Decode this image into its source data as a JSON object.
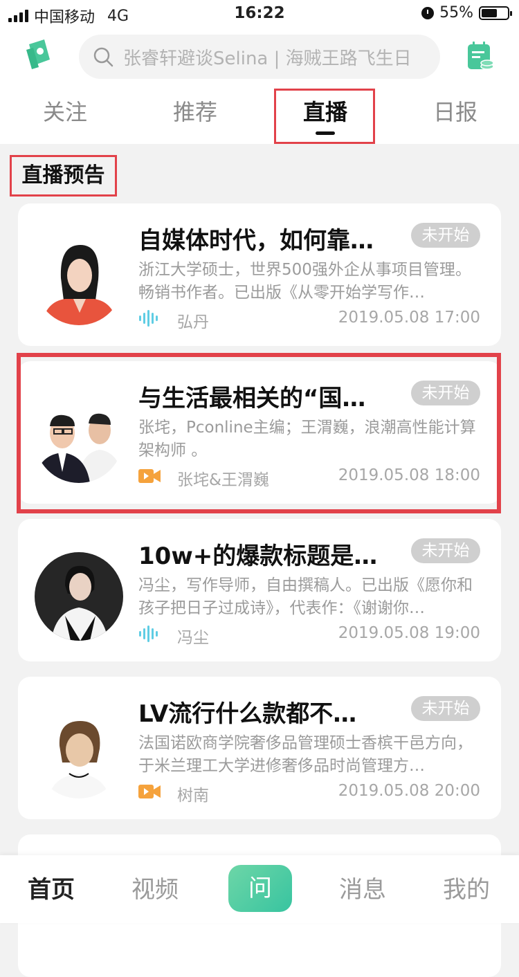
{
  "status_bar": {
    "carrier": "中国移动",
    "network": "4G",
    "time": "16:22",
    "battery": "55%",
    "battery_level": 0.55
  },
  "header": {
    "logo_icon": "app-logo-icon",
    "search_placeholder": "张睿轩避谈Selina | 海贼王路飞生日",
    "calendar_icon": "calendar-icon"
  },
  "tabs": [
    {
      "label": "关注",
      "active": false
    },
    {
      "label": "推荐",
      "active": false
    },
    {
      "label": "直播",
      "active": true
    },
    {
      "label": "日报",
      "active": false
    }
  ],
  "section_title": "直播预告",
  "lives": [
    {
      "title": "自媒体时代，如何靠…",
      "status": "未开始",
      "desc": "浙江大学硕士，世界500强外企从事项目管理。畅销书作者。已出版《从零开始学写作…",
      "type_icon": "audio-wave-icon",
      "author": "弘丹",
      "time": "2019.05.08 17:00"
    },
    {
      "title": "与生活最相关的“国…",
      "status": "未开始",
      "desc": "张垞，Pconline主编；王渭巍，浪潮高性能计算架构师 。",
      "type_icon": "video-camera-icon",
      "author": "张垞&王渭巍",
      "time": "2019.05.08 18:00"
    },
    {
      "title": "10w+的爆款标题是…",
      "status": "未开始",
      "desc": "冯尘，写作导师，自由撰稿人。已出版《愿你和孩子把日子过成诗》，代表作：《谢谢你…",
      "type_icon": "audio-wave-icon",
      "author": "冯尘",
      "time": "2019.05.08 19:00"
    },
    {
      "title": "LV流行什么款都不…",
      "status": "未开始",
      "desc": "法国诺欧商学院奢侈品管理硕士香槟干邑方向，于米兰理工大学进修奢侈品时尚管理方…",
      "type_icon": "video-camera-icon",
      "author": "树南",
      "time": "2019.05.08 20:00"
    }
  ],
  "bottom_nav": {
    "home": "首页",
    "video": "视频",
    "ask": "问",
    "messages": "消息",
    "me": "我的"
  },
  "colors": {
    "accent": "#38c4a0",
    "highlight": "#e2424a",
    "audio_icon": "#5fcde4",
    "video_icon": "#f5a23c"
  }
}
